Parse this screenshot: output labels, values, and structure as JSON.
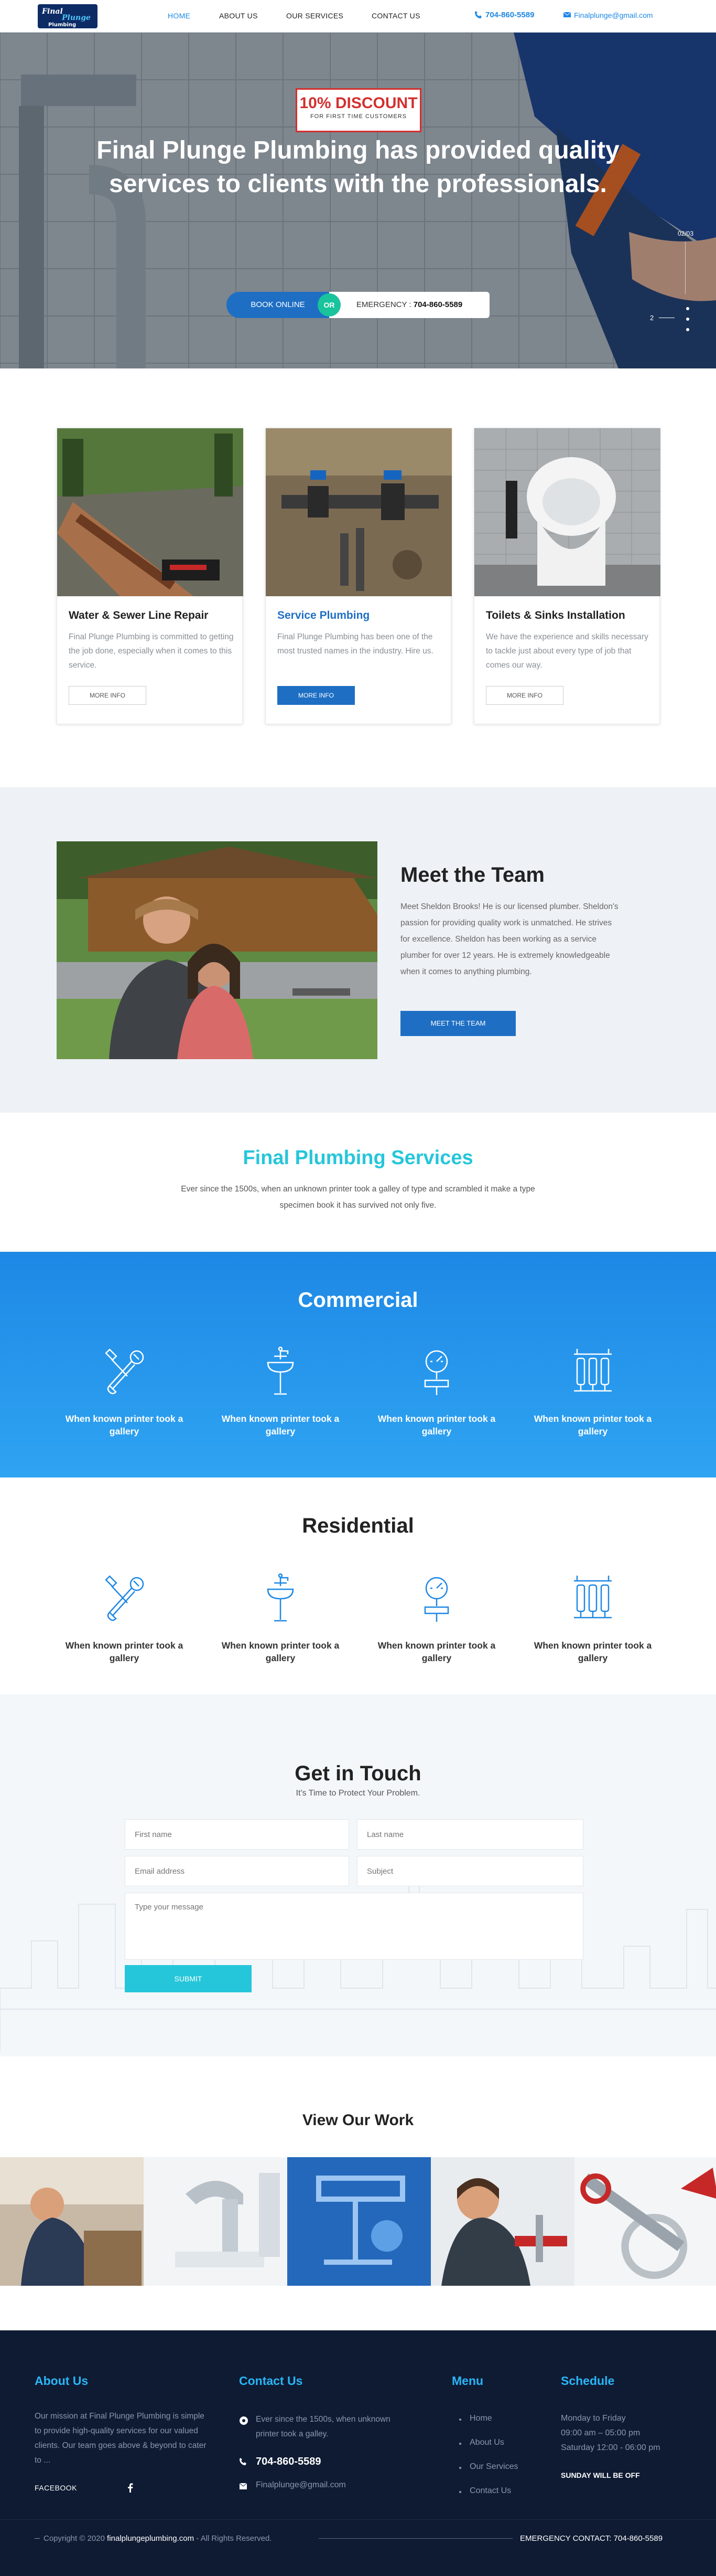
{
  "header": {
    "logo_text": "Final Plunge Plumbing",
    "nav": [
      {
        "label": "HOME"
      },
      {
        "label": "ABOUT US"
      },
      {
        "label": "OUR SERVICES"
      },
      {
        "label": "CONTACT US"
      }
    ],
    "phone": "704-860-5589",
    "email": "Finalplunge@gmail.com"
  },
  "hero": {
    "discount_title": "10% DISCOUNT",
    "discount_sub": "FOR FIRST TIME CUSTOMERS",
    "headline": "Final Plunge Plumbing has provided quality services to clients with the professionals.",
    "book_label": "BOOK ONLINE",
    "or_label": "OR",
    "emergency_label": "EMERGENCY : ",
    "emergency_phone": "704-860-5589",
    "slide_count": "02/03",
    "slide_num": "2"
  },
  "services": [
    {
      "title": "Water & Sewer Line Repair",
      "text": "Final Plunge Plumbing is committed to getting the job done, especially when it comes to this service.",
      "button": "MORE INFO"
    },
    {
      "title": "Service Plumbing",
      "text": "Final Plunge Plumbing has been one of the most trusted names in the industry. Hire us.",
      "button": "MORE INFO"
    },
    {
      "title": "Toilets & Sinks Installation",
      "text": "We have the experience and skills necessary to tackle just about every type of job that comes our way.",
      "button": "MORE INFO"
    }
  ],
  "team": {
    "title": "Meet the Team",
    "text": "Meet Sheldon Brooks! He is our licensed plumber. Sheldon's passion for providing quality work is unmatched. He strives for excellence. Sheldon has been working as a service plumber for over 12 years. He is extremely knowledgeable when it comes to anything plumbing.",
    "button": "MEET THE TEAM"
  },
  "fps": {
    "title": "Final Plumbing Services",
    "text": "Ever since the 1500s, when an unknown printer took a galley of type and scrambled it make a type specimen book it has survived not only five."
  },
  "commercial": {
    "title": "Commercial",
    "items": [
      {
        "label": "When known printer took a gallery",
        "icon": "wrench-icon"
      },
      {
        "label": "When known printer took a gallery",
        "icon": "faucet-icon"
      },
      {
        "label": "When known printer took a gallery",
        "icon": "pressure-gauge-icon"
      },
      {
        "label": "When known printer took a gallery",
        "icon": "water-filter-icon"
      }
    ]
  },
  "residential": {
    "title": "Residential",
    "items": [
      {
        "label": "When known printer took a gallery",
        "icon": "wrench-icon"
      },
      {
        "label": "When known printer took a gallery",
        "icon": "faucet-icon"
      },
      {
        "label": "When known printer took a gallery",
        "icon": "pressure-gauge-icon"
      },
      {
        "label": "When known printer took a gallery",
        "icon": "water-filter-icon"
      }
    ]
  },
  "contact": {
    "title": "Get in Touch",
    "subtitle": "It's Time to Protect Your Problem.",
    "first_name": "First name",
    "last_name": "Last name",
    "email": "Email address",
    "subject": "Subject",
    "message": "Type your message",
    "submit": "SUBMIT"
  },
  "work": {
    "title": "View Our Work"
  },
  "footer": {
    "about_title": "About Us",
    "about_text": "Our mission at Final Plunge Plumbing is simple to provide high-quality services for our valued clients. Our team goes above & beyond to cater to ...",
    "facebook": "FACEBOOK",
    "contact_title": "Contact Us",
    "contact_text": "Ever since the 1500s, when unknown printer took a galley.",
    "contact_phone": "704-860-5589",
    "contact_email": "Finalplunge@gmail.com",
    "menu_title": "Menu",
    "menu": [
      "Home",
      "About Us",
      "Our Services",
      "Contact Us"
    ],
    "schedule_title": "Schedule",
    "schedule_days": "Monday to Friday",
    "schedule_hours": "09:00 am – 05:00 pm",
    "schedule_sat": "Saturday 12:00 - 06:00 pm",
    "schedule_sun": "SUNDAY WILL BE OFF",
    "copyright_pre": "Copyright © 2020 ",
    "copyright_site": "finalplungeplumbing.com",
    "copyright_post": " - All Rights Reserved.",
    "emergency": "EMERGENCY CONTACT: 704-860-5589"
  },
  "colors": {
    "primary_blue": "#1e6fc4",
    "accent_cyan": "#26c6da",
    "footer_bg": "#0f1b33",
    "discount_red": "#d32f2f"
  }
}
